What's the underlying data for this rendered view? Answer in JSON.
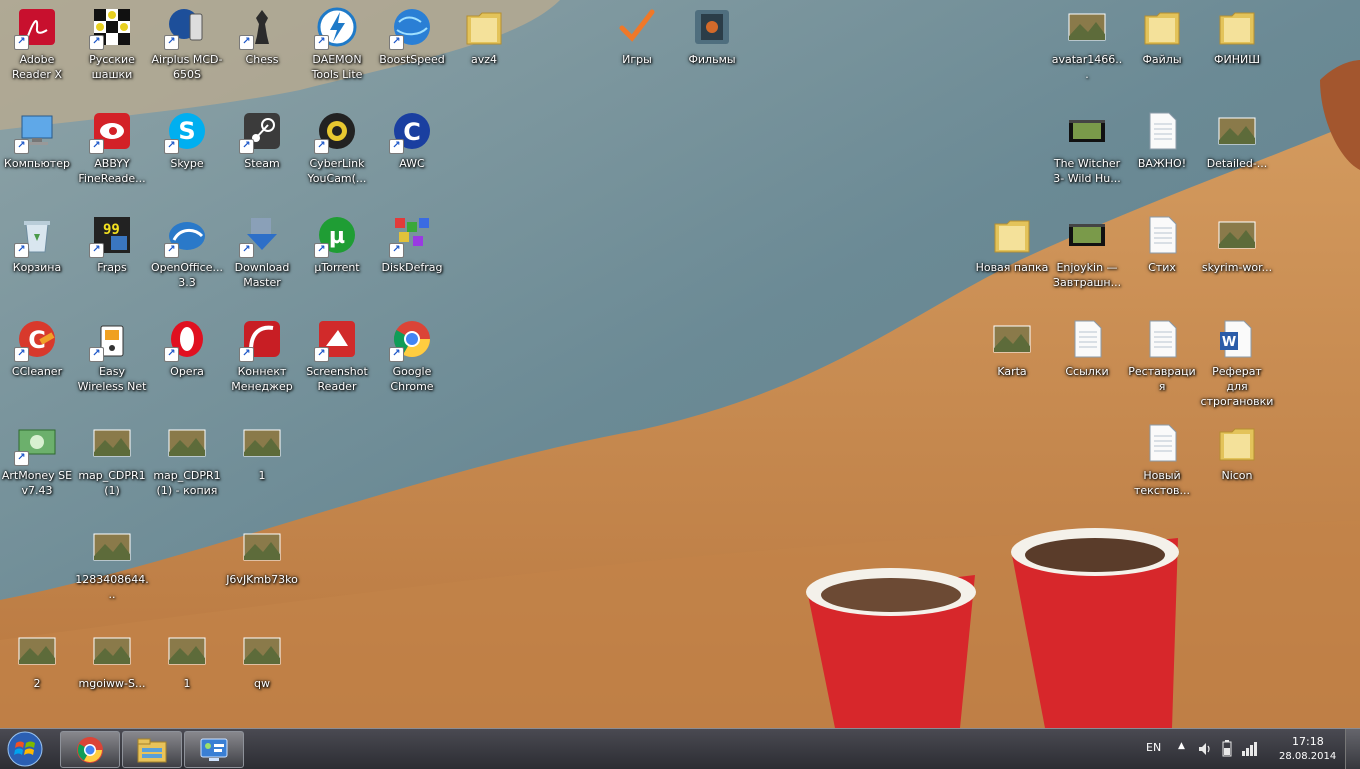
{
  "desktop": {
    "icons": [
      {
        "label": "Adobe Reader X",
        "icon": "adobe-reader-icon"
      },
      {
        "label": "Русские шашки",
        "icon": "checkers-icon"
      },
      {
        "label": "Airplus MCD-650S",
        "icon": "airplus-modem-icon"
      },
      {
        "label": "Chess",
        "icon": "chess-icon"
      },
      {
        "label": "DAEMON Tools Lite",
        "icon": "daemon-tools-icon"
      },
      {
        "label": "BoostSpeed",
        "icon": "boostspeed-icon"
      },
      {
        "label": "avz4",
        "icon": "folder-icon"
      },
      {
        "label": "Игры",
        "icon": "games-check-icon"
      },
      {
        "label": "Фильмы",
        "icon": "movies-icon"
      },
      {
        "label": "avatar1466...",
        "icon": "image-file-icon"
      },
      {
        "label": "Файлы",
        "icon": "folder-icon"
      },
      {
        "label": "ФИНИШ",
        "icon": "folder-icon"
      },
      {
        "label": "Компьютер",
        "icon": "computer-icon"
      },
      {
        "label": "ABBYY FineReade...",
        "icon": "abbyy-icon"
      },
      {
        "label": "Skype",
        "icon": "skype-icon"
      },
      {
        "label": "Steam",
        "icon": "steam-icon"
      },
      {
        "label": "CyberLink YouCam(...",
        "icon": "youcam-icon"
      },
      {
        "label": "AWC",
        "icon": "awc-icon"
      },
      {
        "label": "The Witcher 3- Wild Hu...",
        "icon": "video-file-icon"
      },
      {
        "label": "ВАЖНО!",
        "icon": "text-file-icon"
      },
      {
        "label": "Detailed-...",
        "icon": "image-file-icon"
      },
      {
        "label": "Корзина",
        "icon": "recycle-bin-icon"
      },
      {
        "label": "Fraps",
        "icon": "fraps-icon"
      },
      {
        "label": "OpenOffice... 3.3",
        "icon": "openoffice-icon"
      },
      {
        "label": "Download Master",
        "icon": "download-master-icon"
      },
      {
        "label": "µTorrent",
        "icon": "utorrent-icon"
      },
      {
        "label": "DiskDefrag",
        "icon": "diskdefrag-icon"
      },
      {
        "label": "Новая папка",
        "icon": "folder-icon"
      },
      {
        "label": "Enjoykin — Завтрашн...",
        "icon": "video-file-icon"
      },
      {
        "label": "Стих",
        "icon": "text-file-icon"
      },
      {
        "label": "skyrim-wor...",
        "icon": "image-file-icon"
      },
      {
        "label": "CCleaner",
        "icon": "ccleaner-icon"
      },
      {
        "label": "Easy Wireless Net",
        "icon": "wireless-icon"
      },
      {
        "label": "Opera",
        "icon": "opera-icon"
      },
      {
        "label": "Коннект Менеджер",
        "icon": "connect-manager-icon"
      },
      {
        "label": "Screenshot Reader",
        "icon": "screenshot-reader-icon"
      },
      {
        "label": "Google Chrome",
        "icon": "chrome-icon"
      },
      {
        "label": "Karta",
        "icon": "image-file-icon"
      },
      {
        "label": "Ссылки",
        "icon": "text-file-icon"
      },
      {
        "label": "Реставрация",
        "icon": "text-file-icon"
      },
      {
        "label": "Реферат для строгановки",
        "icon": "word-doc-icon"
      },
      {
        "label": "ArtMoney SE v7.43",
        "icon": "artmoney-icon"
      },
      {
        "label": "map_CDPR1 (1)",
        "icon": "image-file-icon"
      },
      {
        "label": "map_CDPR1 (1) - копия",
        "icon": "image-file-icon"
      },
      {
        "label": "1",
        "icon": "image-file-icon"
      },
      {
        "label": "Новый текстов...",
        "icon": "text-file-icon"
      },
      {
        "label": "Nicon",
        "icon": "folder-icon"
      },
      {
        "label": "1283408644...",
        "icon": "image-file-icon"
      },
      {
        "label": "J6vJKmb73ko",
        "icon": "image-file-icon"
      },
      {
        "label": "2",
        "icon": "image-file-icon"
      },
      {
        "label": "mgoiww-S...",
        "icon": "image-file-icon"
      },
      {
        "label": "1",
        "icon": "image-file-icon"
      },
      {
        "label": "qw",
        "icon": "image-file-icon"
      }
    ]
  },
  "taskbar": {
    "pinned": [
      {
        "name": "Google Chrome",
        "icon": "chrome-icon"
      },
      {
        "name": "Windows Explorer",
        "icon": "explorer-icon"
      },
      {
        "name": "Control Panel",
        "icon": "control-panel-icon"
      }
    ],
    "language": "EN",
    "time": "17:18",
    "date": "28.08.2014"
  },
  "colors": {
    "sea": "#6d8c97",
    "sand": "#c98a4e",
    "taskbar": "#3a3b42",
    "cup_red": "#d7272b"
  }
}
